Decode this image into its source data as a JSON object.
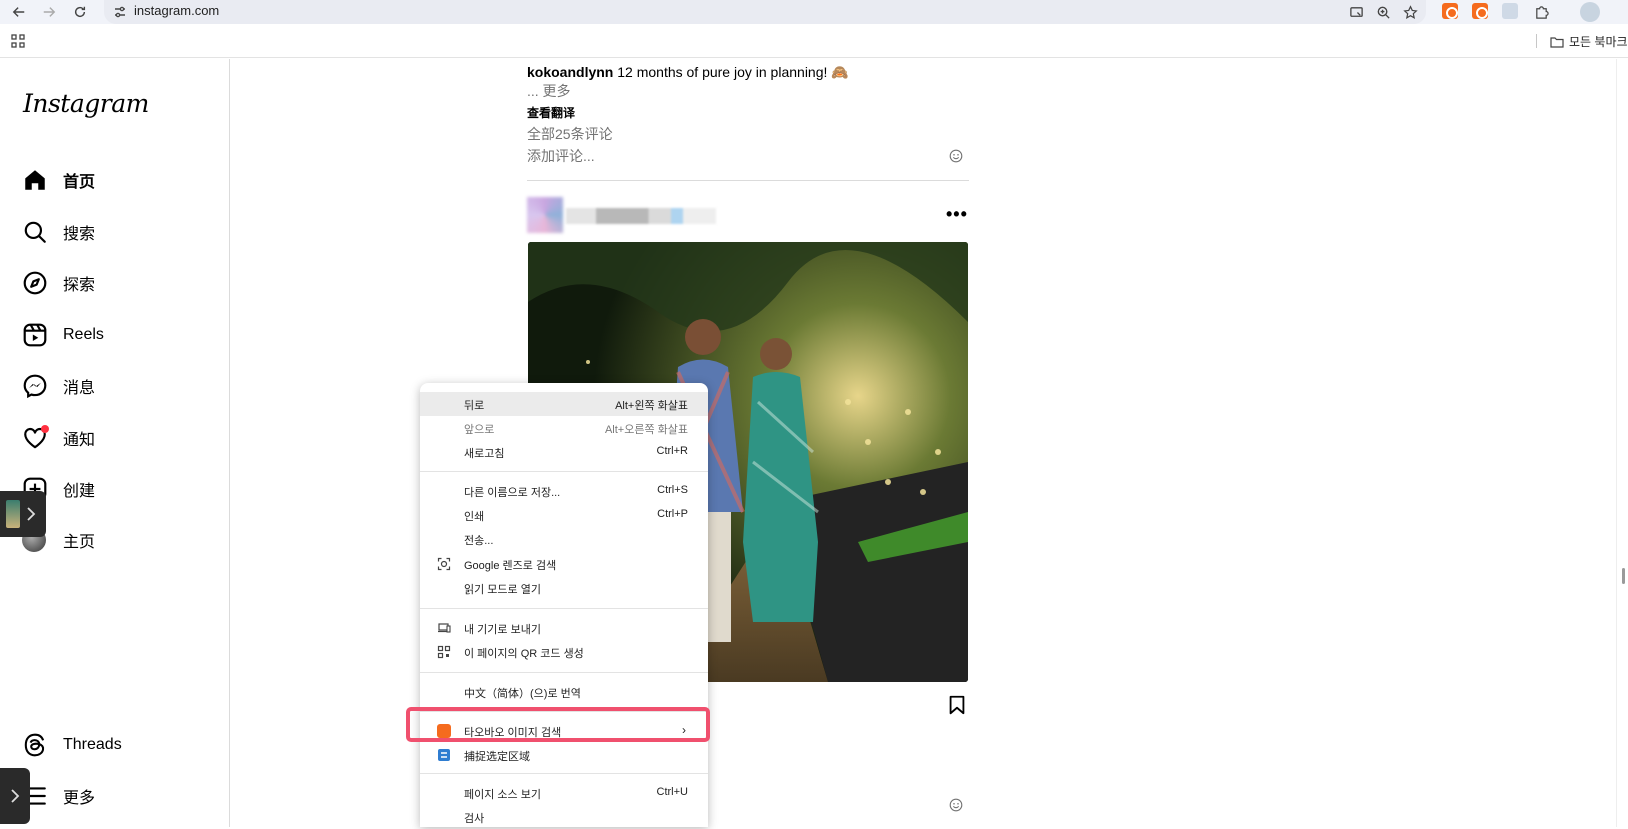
{
  "browser": {
    "url": "instagram.com",
    "bookmarks_folder": "모든 북마크"
  },
  "sidebar": {
    "logo": "Instagram",
    "items": [
      {
        "label": "首页",
        "icon": "home-icon"
      },
      {
        "label": "搜索",
        "icon": "search-icon"
      },
      {
        "label": "探索",
        "icon": "compass-icon"
      },
      {
        "label": "Reels",
        "icon": "reels-icon"
      },
      {
        "label": "消息",
        "icon": "messenger-icon"
      },
      {
        "label": "通知",
        "icon": "heart-icon"
      },
      {
        "label": "创建",
        "icon": "create-icon"
      },
      {
        "label": "主页",
        "icon": "avatar"
      },
      {
        "label": "Threads",
        "icon": "threads-icon"
      },
      {
        "label": "更多",
        "icon": "menu-icon"
      }
    ]
  },
  "feed": {
    "caption_user": "kokoandlynn",
    "caption_text": "12 months of pure joy in planning! 🙈",
    "more": "... 更多",
    "translate": "查看翻译",
    "view_comments": "全部25条评论",
    "add_comment": "添加评论..."
  },
  "context_menu": {
    "items": [
      {
        "label": "뒤로",
        "shortcut": "Alt+왼쪽 화살표"
      },
      {
        "label": "앞으로",
        "shortcut": "Alt+오른쪽 화살표"
      },
      {
        "label": "새로고침",
        "shortcut": "Ctrl+R"
      },
      {
        "label": "다른 이름으로 저장...",
        "shortcut": "Ctrl+S"
      },
      {
        "label": "인쇄",
        "shortcut": "Ctrl+P"
      },
      {
        "label": "전송..."
      },
      {
        "label": "Google 렌즈로 검색",
        "icon": "lens-icon"
      },
      {
        "label": "읽기 모드로 열기"
      },
      {
        "label": "내 기기로 보내기",
        "icon": "device-icon"
      },
      {
        "label": "이 페이지의 QR 코드 생성",
        "icon": "qr-icon"
      },
      {
        "label": "中文（简体）(으)로 번역"
      },
      {
        "label": "타오바오 이미지 검색",
        "icon": "taobao-icon"
      },
      {
        "label": "捕捉选定区域",
        "icon": "capture-icon"
      },
      {
        "label": "페이지 소스 보기",
        "shortcut": "Ctrl+U"
      },
      {
        "label": "검사"
      }
    ]
  },
  "colors": {
    "highlight": "#f0506e",
    "notification_dot": "#ff3040",
    "taobao": "#f56b1e"
  }
}
